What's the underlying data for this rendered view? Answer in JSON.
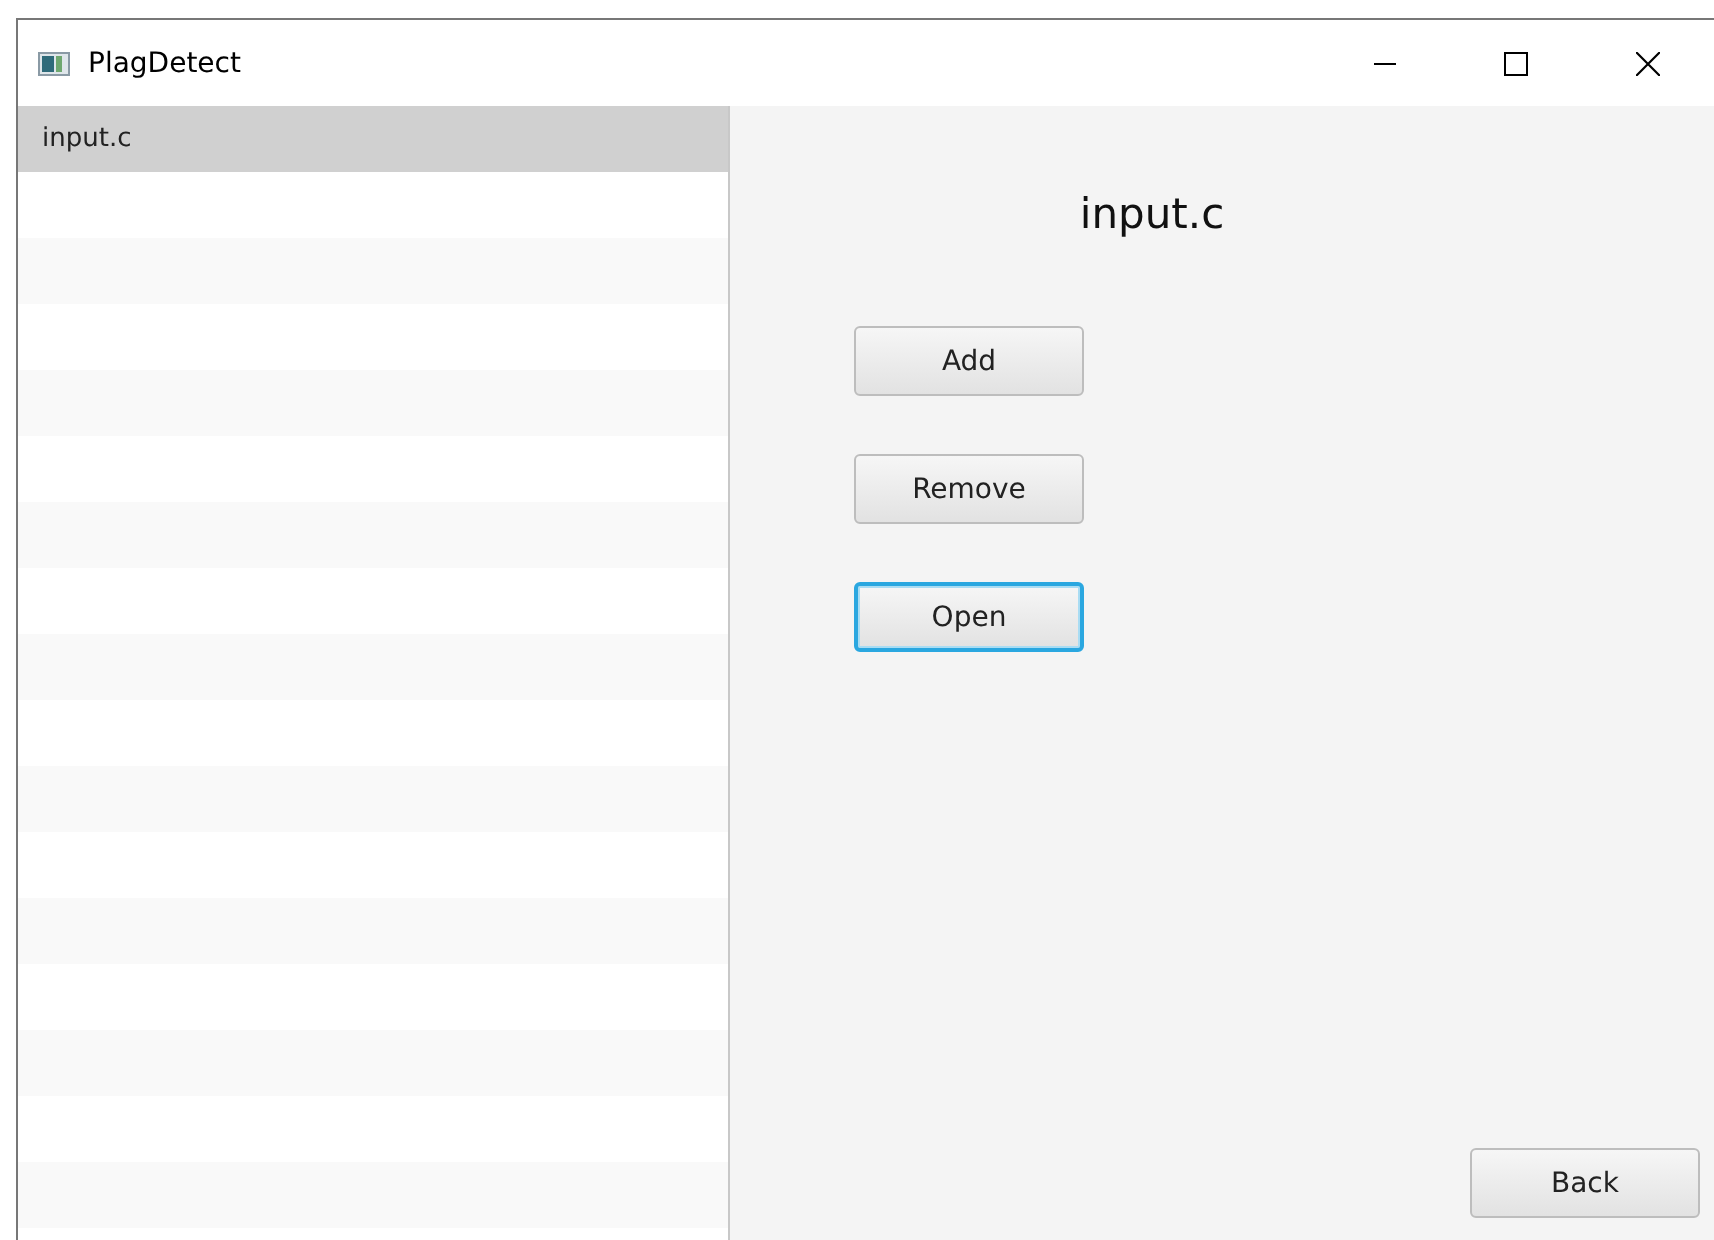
{
  "window": {
    "title": "PlagDetect"
  },
  "file_list": [
    {
      "name": "input.c",
      "selected": true
    }
  ],
  "detail": {
    "title": "input.c",
    "buttons": [
      {
        "label": "Add",
        "focused": false
      },
      {
        "label": "Remove",
        "focused": false
      },
      {
        "label": "Open",
        "focused": true
      }
    ],
    "back_button": {
      "label": "Back",
      "focused": false
    }
  }
}
